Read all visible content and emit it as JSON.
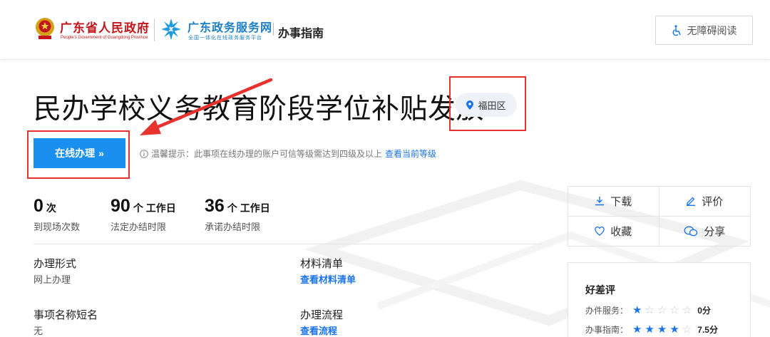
{
  "header": {
    "gov_name": "广东省人民政府",
    "gov_name_en": "People's Government of Guangdong Province",
    "portal_name": "广东政务服务网",
    "portal_sub": "全国一体化在线政务服务平台",
    "nav_title": "办事指南",
    "accessibility_label": "无障碍阅读"
  },
  "main": {
    "title": "民办学校义务教育阶段学位补贴发放",
    "district": "福田区",
    "online_button": "在线办理",
    "tip_text": "温馨提示：此事项在线办理的账户可信等级需达到四级及以上",
    "tip_link": "查看当前等级"
  },
  "stats": [
    {
      "num": "0",
      "unit": "次",
      "label": "到现场次数"
    },
    {
      "num": "90",
      "unit": "个 工作日",
      "label": "法定办结时限"
    },
    {
      "num": "36",
      "unit": "个 工作日",
      "label": "承诺办结时限"
    }
  ],
  "info": {
    "form_title": "办理形式",
    "form_value": "网上办理",
    "materials_title": "材料清单",
    "materials_link": "查看材料清单",
    "short_name_title": "事项名称短名",
    "short_name_value": "无",
    "process_title": "办理流程",
    "process_link": "查看流程"
  },
  "actions": {
    "download": "下载",
    "evaluate": "评价",
    "favorite": "收藏",
    "share": "分享"
  },
  "rating": {
    "title": "好差评",
    "service_label": "办件服务：",
    "service_stars": 1,
    "service_score": "0分",
    "guide_label": "办事指南：",
    "guide_stars": 4,
    "guide_score": "7.5分"
  },
  "colors": {
    "accent": "#1a8ff0",
    "link": "#1a73e8",
    "annotation": "#e7322e",
    "gov_red": "#c0161c"
  }
}
